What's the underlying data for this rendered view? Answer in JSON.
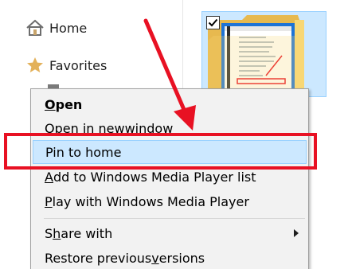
{
  "navigation": {
    "items": [
      {
        "label": "Home",
        "icon": "home-icon"
      },
      {
        "label": "Favorites",
        "icon": "star-icon"
      }
    ]
  },
  "folder_tile": {
    "checked": true,
    "icon": "folder-icon",
    "thumbnail": "folder-options-window-preview"
  },
  "context_menu": {
    "items": [
      {
        "prefix": "",
        "mnemonic": "O",
        "suffix": "pen"
      },
      {
        "prefix": "Open in new ",
        "mnemonic": "w",
        "suffix": "indow"
      },
      {
        "prefix": "Pin to home",
        "mnemonic": "",
        "suffix": ""
      },
      {
        "prefix": "",
        "mnemonic": "A",
        "suffix": "dd to Windows Media Player list"
      },
      {
        "prefix": "",
        "mnemonic": "P",
        "suffix": "lay with Windows Media Player"
      },
      {
        "prefix": "S",
        "mnemonic": "h",
        "suffix": "are with"
      },
      {
        "prefix": "Restore previous ",
        "mnemonic": "v",
        "suffix": "ersions"
      }
    ],
    "bold_item": "Open",
    "highlighted_item": "Pin to home",
    "submenu_item": "Share with"
  },
  "colors": {
    "annotation_red": "#e81123",
    "menu_hover": "#cce8ff",
    "menu_hover_border": "#99d1ff",
    "menu_background": "#f2f2f2",
    "folder_yellow": "#f8d775"
  }
}
